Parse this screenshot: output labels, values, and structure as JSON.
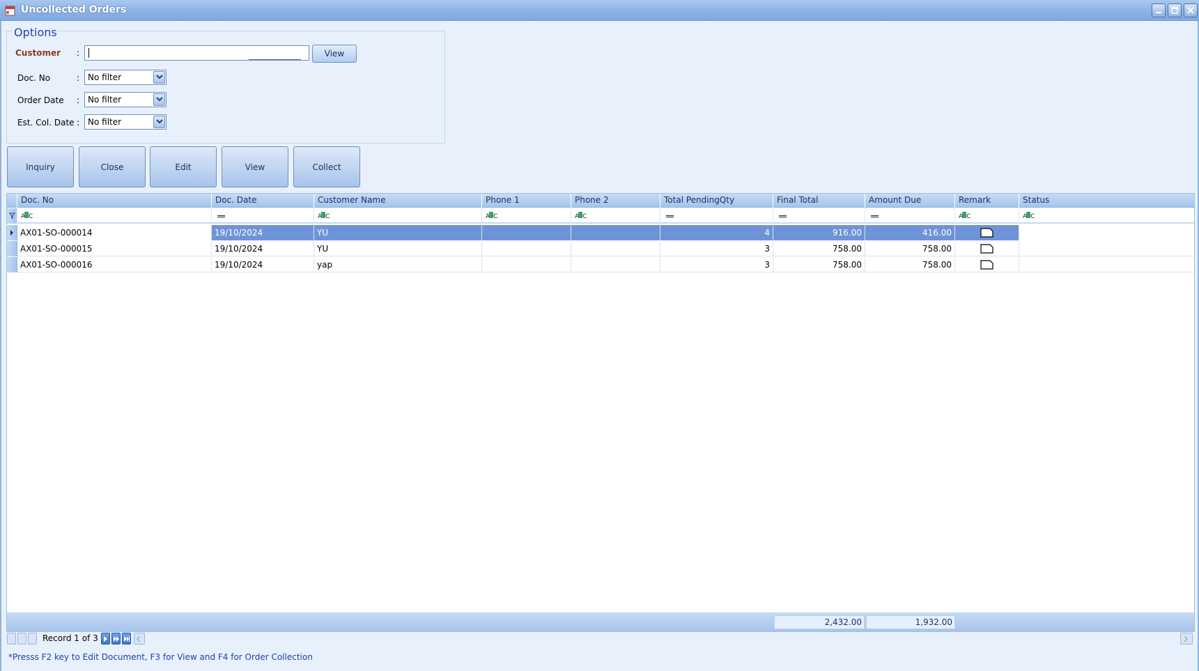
{
  "window": {
    "title": "Uncollected Orders",
    "buttons": [
      "minimize",
      "maximize",
      "close"
    ]
  },
  "options": {
    "title": "Options",
    "customer_label": "Customer",
    "customer_value": "",
    "view_label": "View",
    "docno_label": "Doc. No",
    "docno_value": "No filter",
    "orderdate_label": "Order Date",
    "orderdate_value": "No filter",
    "estcol_label": "Est. Col. Date",
    "estcol_value": "No filter",
    "colon": ":"
  },
  "actions": {
    "inquiry": "Inquiry",
    "close": "Close",
    "edit": "Edit",
    "view": "View",
    "collect": "Collect"
  },
  "grid": {
    "columns": [
      "Doc. No",
      "Doc. Date",
      "Customer Name",
      "Phone 1",
      "Phone 2",
      "Total PendingQty",
      "Final Total",
      "Amount Due",
      "Remark",
      "Status"
    ],
    "rows": [
      {
        "doc_no": "AX01-SO-000014",
        "doc_date": "19/10/2024",
        "customer": "YU",
        "phone1": "",
        "phone2": "",
        "pending_qty": "4",
        "final_total": "916.00",
        "amount_due": "416.00",
        "status": ""
      },
      {
        "doc_no": "AX01-SO-000015",
        "doc_date": "19/10/2024",
        "customer": "YU",
        "phone1": "",
        "phone2": "",
        "pending_qty": "3",
        "final_total": "758.00",
        "amount_due": "758.00",
        "status": ""
      },
      {
        "doc_no": "AX01-SO-000016",
        "doc_date": "19/10/2024",
        "customer": "yap",
        "phone1": "",
        "phone2": "",
        "pending_qty": "3",
        "final_total": "758.00",
        "amount_due": "758.00",
        "status": ""
      }
    ],
    "totals": {
      "final_total": "2,432.00",
      "amount_due": "1,932.00"
    }
  },
  "navigator": {
    "record_text": "Record 1 of 3"
  },
  "hint": "*Presss F2 key to Edit Document, F3 for View and F4 for Order Collection",
  "colors": {
    "accent": "#1d3fb0",
    "selection": "#6f93d8",
    "header": "#a6c4ec"
  }
}
